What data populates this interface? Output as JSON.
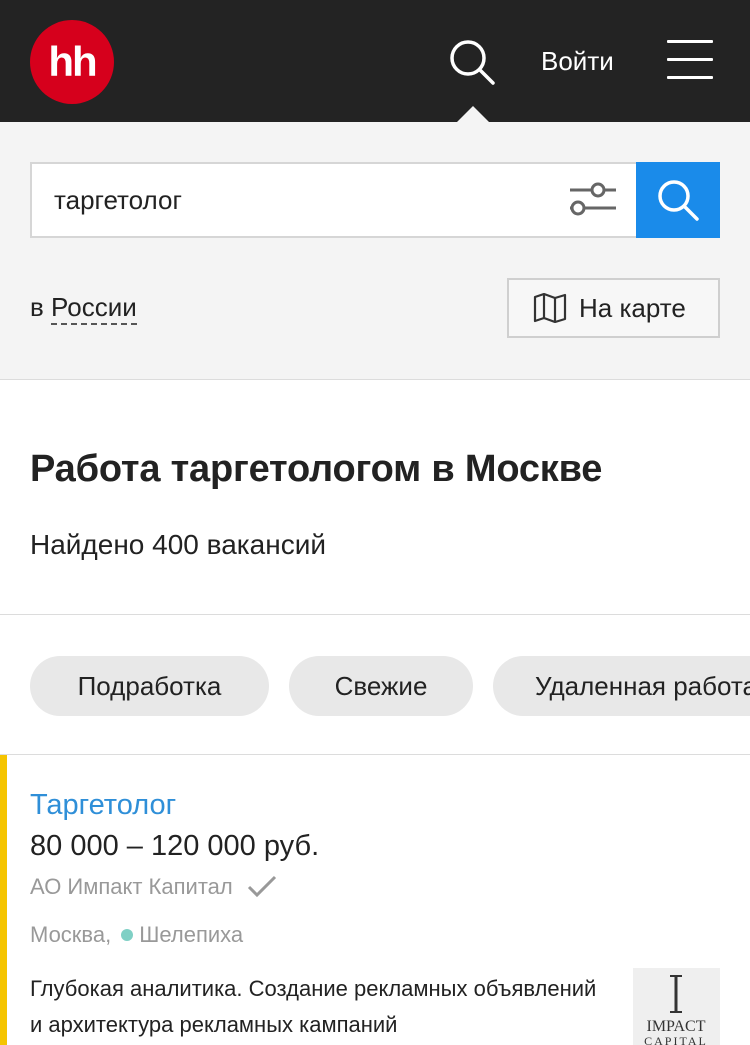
{
  "header": {
    "logo_text": "hh",
    "login_label": "Войти",
    "brand_color": "#d6001c",
    "background_color": "#232323"
  },
  "search": {
    "query": "таргетолог",
    "placeholder": "",
    "filter_icon": "filter-sliders-icon",
    "submit_icon": "search-icon",
    "submit_color": "#1a8bea",
    "region_prefix": "в",
    "region_link": "России",
    "map_button_label": "На карте",
    "map_icon": "map-icon"
  },
  "results": {
    "title": "Работа таргетологом в Москве",
    "found_text": "Найдено 400 вакансий"
  },
  "chips": [
    {
      "label": "Подработка"
    },
    {
      "label": "Свежие"
    },
    {
      "label": "Удаленная работа"
    }
  ],
  "vacancy": {
    "title": "Таргетолог",
    "salary": "80 000 – 120 000 руб.",
    "company": "АО Импакт Капитал",
    "city": "Москва,",
    "metro": "Шелепиха",
    "description": "Глубокая аналитика. Создание рекламных объявлений и архитектура рекламных кампаний",
    "logo_text": "IMPACT CAPITAL",
    "accent_color": "#f5c400",
    "title_color": "#2f8fd8",
    "metro_color": "#7fd0c5"
  }
}
